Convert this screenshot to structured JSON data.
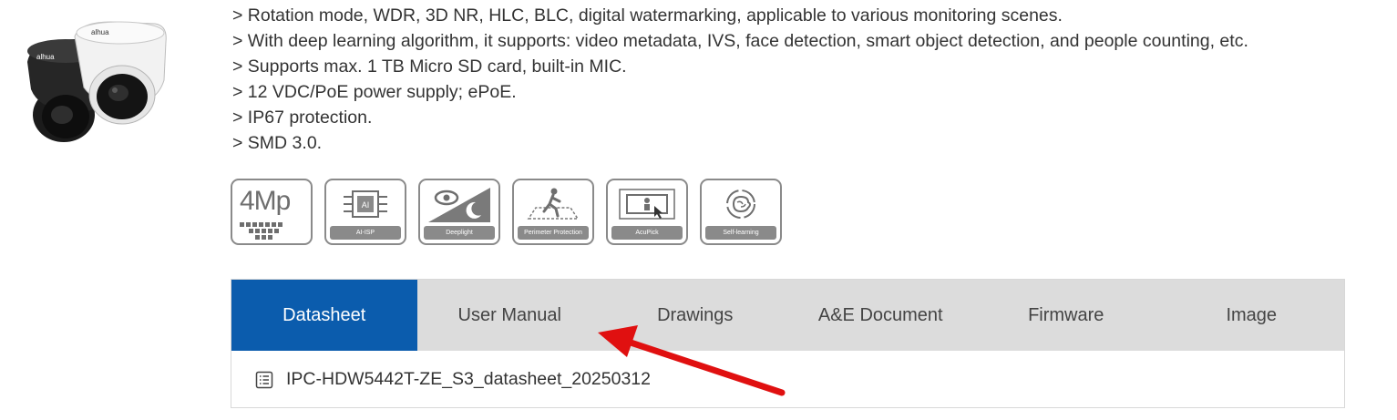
{
  "features": [
    "> Rotation mode, WDR, 3D NR, HLC, BLC, digital watermarking, applicable to various monitoring scenes.",
    "> With deep learning algorithm, it supports: video metadata, IVS, face detection, smart object detection, and people counting, etc.",
    "> Supports max. 1 TB Micro SD card, built-in MIC.",
    "> 12 VDC/PoE power supply; ePoE.",
    "> IP67 protection.",
    "> SMD 3.0."
  ],
  "badges": [
    {
      "label": "4Mp",
      "icon": "4mp-icon"
    },
    {
      "label": "AI-ISP",
      "icon": "ai-chip-icon"
    },
    {
      "label": "Deeplight",
      "icon": "eye-moon-icon"
    },
    {
      "label": "Perimeter Protection",
      "icon": "running-person-icon"
    },
    {
      "label": "AcuPick",
      "icon": "acupick-icon"
    },
    {
      "label": "Self-learning",
      "icon": "brain-icon"
    }
  ],
  "brand": "alhua",
  "tabs": [
    {
      "label": "Datasheet",
      "active": true
    },
    {
      "label": "User Manual",
      "active": false
    },
    {
      "label": "Drawings",
      "active": false
    },
    {
      "label": "A&E Document",
      "active": false
    },
    {
      "label": "Firmware",
      "active": false
    },
    {
      "label": "Image",
      "active": false
    }
  ],
  "documents": [
    {
      "name": "IPC-HDW5442T-ZE_S3_datasheet_20250312",
      "icon": "document-list-icon"
    }
  ],
  "colors": {
    "active_tab": "#0b5cad",
    "tab_bar": "#dcdcdc",
    "annotation_arrow": "#e01010"
  }
}
